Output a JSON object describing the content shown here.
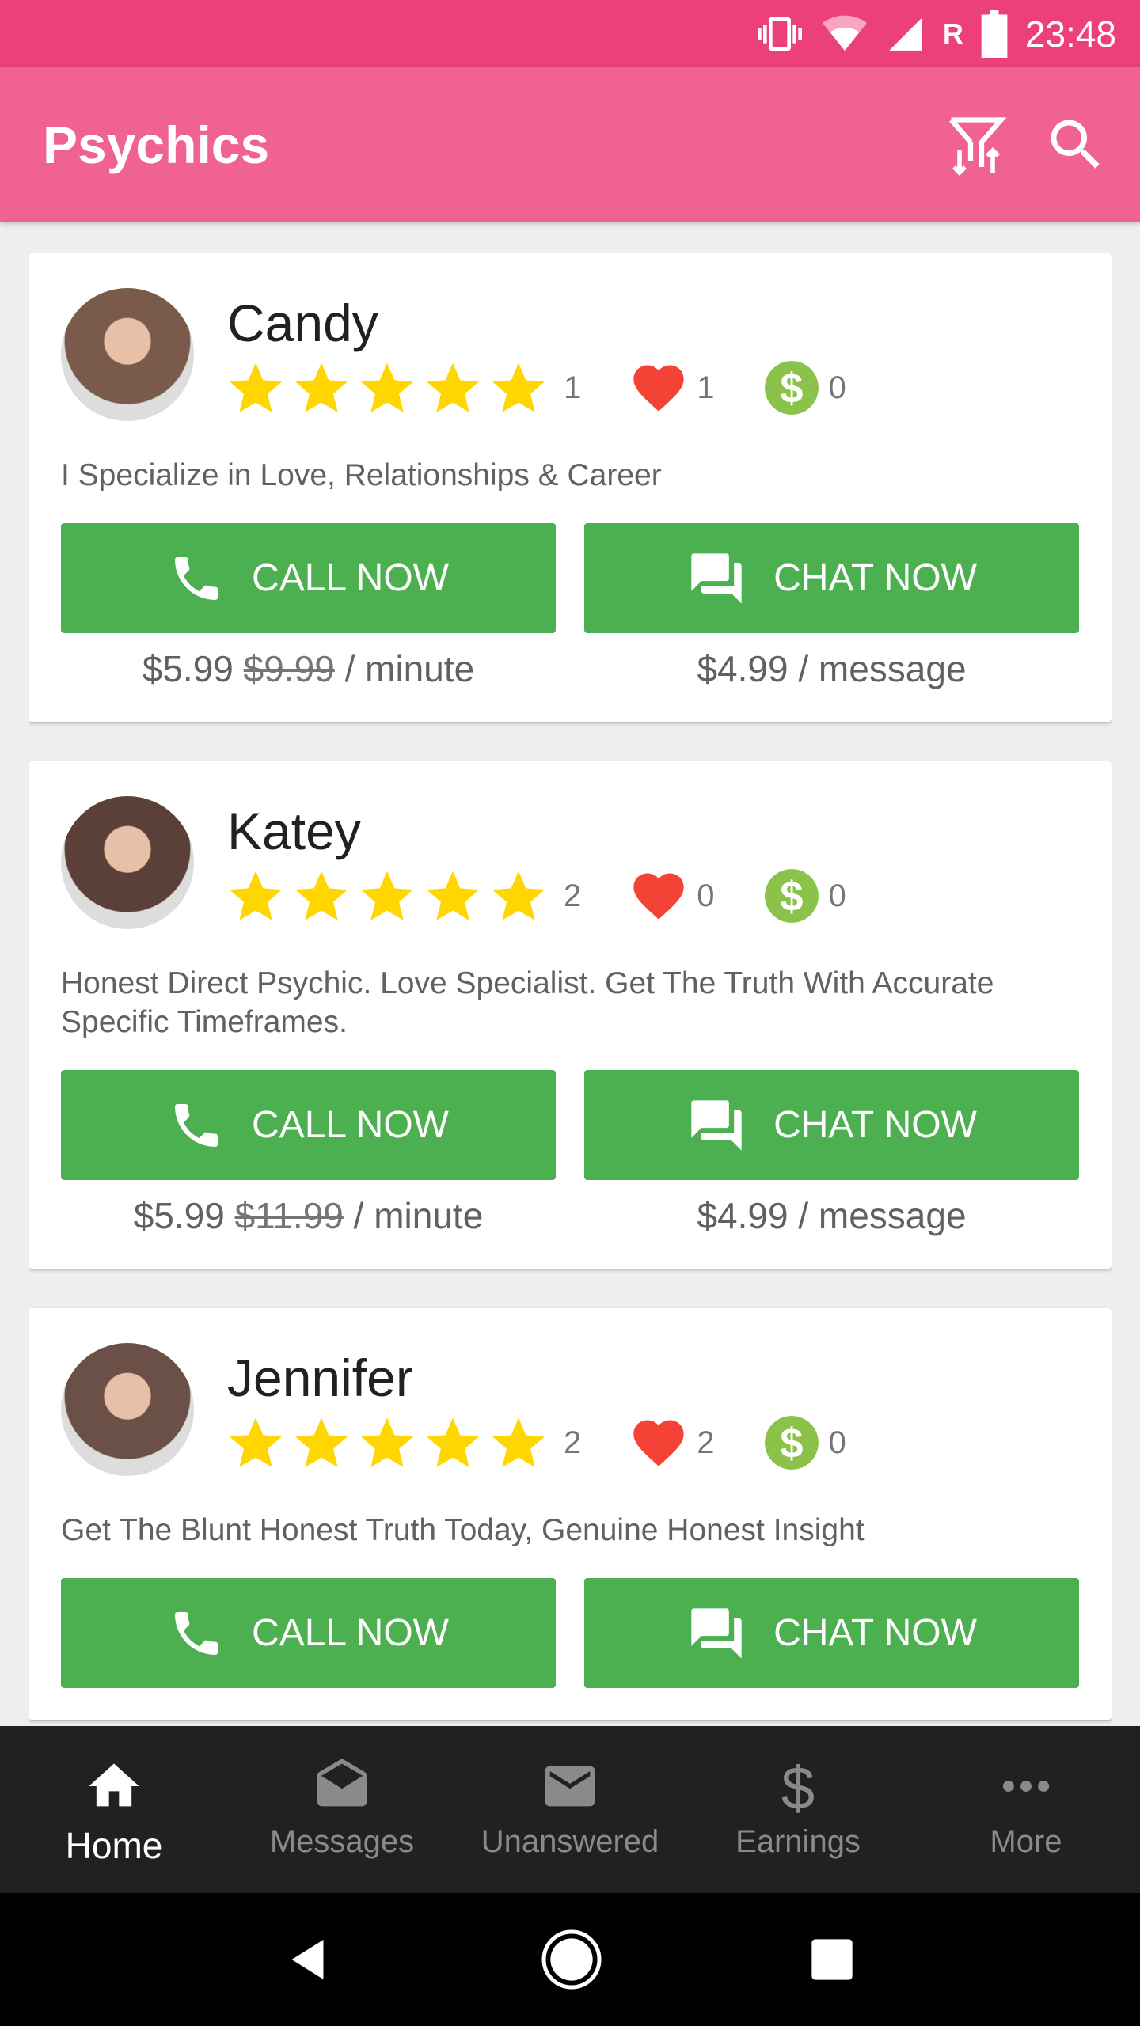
{
  "status_bar": {
    "time": "23:48",
    "network_label": "R"
  },
  "app_bar": {
    "title": "Psychics",
    "icons": [
      "filter-sort-icon",
      "search-icon"
    ]
  },
  "colors": {
    "status_bar": "#ec407a",
    "app_bar": "#f06292",
    "button": "#4caf50",
    "star": "#ffd600",
    "heart": "#f44336",
    "dollar": "#8bc34a"
  },
  "psychics": [
    {
      "name": "Candy",
      "rating": 5,
      "reviews": "1",
      "favorites": "1",
      "earnings": "0",
      "description": "I Specialize in Love, Relationships & Career",
      "call_label": "CALL NOW",
      "chat_label": "CHAT NOW",
      "call_price": "$5.99",
      "call_old_price": "$9.99",
      "call_unit": "/ minute",
      "chat_price": "$4.99 / message",
      "avatar_color": "#7a5a4a"
    },
    {
      "name": "Katey",
      "rating": 5,
      "reviews": "2",
      "favorites": "0",
      "earnings": "0",
      "description": "Honest Direct Psychic. Love Specialist. Get The Truth With Accurate Specific Timeframes.",
      "call_label": "CALL NOW",
      "chat_label": "CHAT NOW",
      "call_price": "$5.99",
      "call_old_price": "$11.99",
      "call_unit": "/ minute",
      "chat_price": "$4.99 / message",
      "avatar_color": "#5a4038"
    },
    {
      "name": "Jennifer",
      "rating": 5,
      "reviews": "2",
      "favorites": "2",
      "earnings": "0",
      "description": "Get The Blunt Honest Truth Today, Genuine Honest Insight",
      "call_label": "CALL NOW",
      "chat_label": "CHAT NOW",
      "avatar_color": "#6b5048"
    }
  ],
  "bottom_nav": [
    {
      "label": "Home",
      "icon": "home-icon",
      "active": true
    },
    {
      "label": "Messages",
      "icon": "messages-icon",
      "active": false
    },
    {
      "label": "Unanswered",
      "icon": "envelope-icon",
      "active": false
    },
    {
      "label": "Earnings",
      "icon": "dollar-icon",
      "active": false
    },
    {
      "label": "More",
      "icon": "more-icon",
      "active": false
    }
  ]
}
